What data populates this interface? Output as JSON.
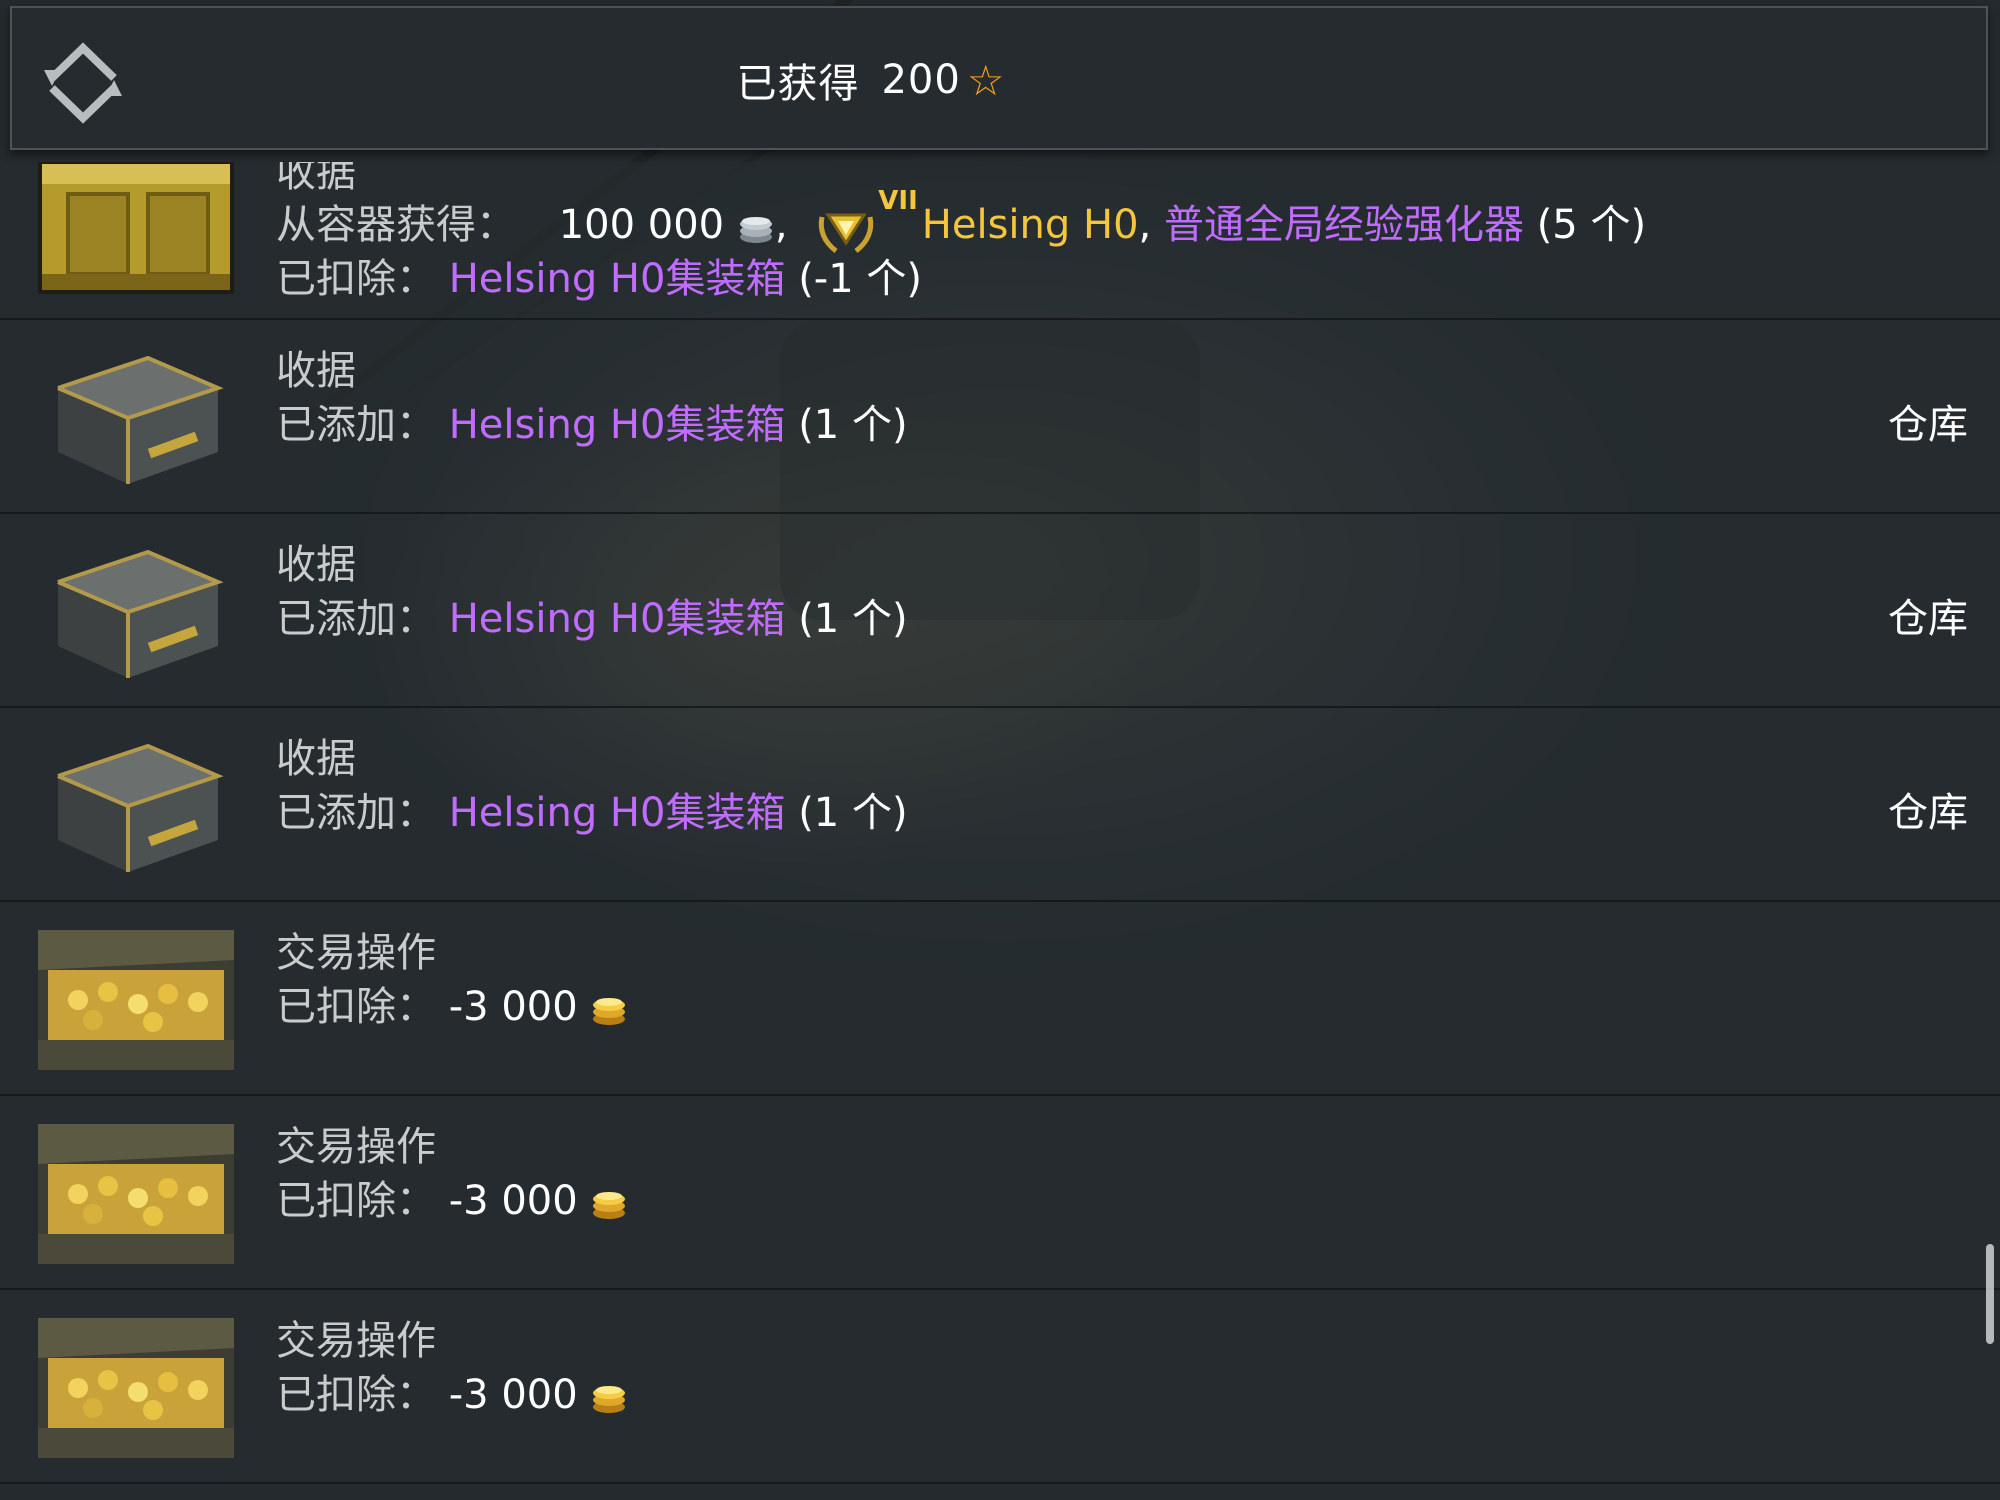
{
  "header": {
    "title": "已获得",
    "value": "200",
    "star": "☆"
  },
  "rows": [
    {
      "type": "receipt-opened",
      "title": "收据",
      "obtained_label": "从容器获得：",
      "silver_amount": "100 000",
      "comma1": ",",
      "tier": "VII",
      "vehicle": "Helsing H0",
      "comma2": ",",
      "booster": "普通全局经验强化器",
      "booster_count": "(5 个)",
      "deducted_label": "已扣除：",
      "container": "Helsing H0集装箱",
      "container_count": "(-1 个)"
    },
    {
      "type": "receipt-added",
      "title": "收据",
      "label": "已添加：",
      "item": "Helsing H0集装箱",
      "count": "(1 个)",
      "link": "仓库"
    },
    {
      "type": "receipt-added",
      "title": "收据",
      "label": "已添加：",
      "item": "Helsing H0集装箱",
      "count": "(1 个)",
      "link": "仓库"
    },
    {
      "type": "receipt-added",
      "title": "收据",
      "label": "已添加：",
      "item": "Helsing H0集装箱",
      "count": "(1 个)",
      "link": "仓库"
    },
    {
      "type": "transaction",
      "title": "交易操作",
      "label": "已扣除：",
      "amount": "-3 000"
    },
    {
      "type": "transaction",
      "title": "交易操作",
      "label": "已扣除：",
      "amount": "-3 000"
    },
    {
      "type": "transaction",
      "title": "交易操作",
      "label": "已扣除：",
      "amount": "-3 000"
    }
  ],
  "colors": {
    "accent_purple": "#c06dff",
    "gold": "#f4c63d",
    "star": "#f5a21d"
  },
  "icons": {
    "back": "back-arrows-icon",
    "silver": "silver-coins-icon",
    "gold": "gold-coins-icon",
    "tier_badge": "tier-badge-icon"
  }
}
